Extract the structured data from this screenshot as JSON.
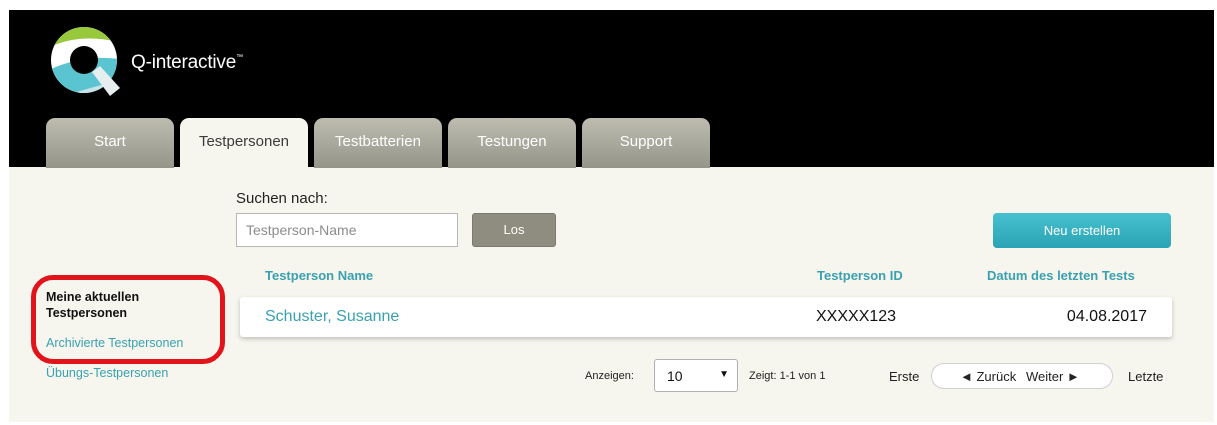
{
  "app": {
    "brand": "Q-interactive",
    "trademark": "™"
  },
  "tabs": [
    {
      "label": "Start"
    },
    {
      "label": "Testpersonen",
      "active": true
    },
    {
      "label": "Testbatterien"
    },
    {
      "label": "Testungen"
    },
    {
      "label": "Support"
    }
  ],
  "search": {
    "label": "Suchen nach:",
    "placeholder": "Testperson-Name",
    "value": "",
    "button_label": "Los"
  },
  "actions": {
    "new_label": "Neu erstellen"
  },
  "sidebar": {
    "items": [
      {
        "label": "Meine aktuellen Testpersonen",
        "active": true
      },
      {
        "label": "Archivierte Testpersonen"
      },
      {
        "label": "Übungs-Testpersonen"
      }
    ]
  },
  "table": {
    "columns": [
      "Testperson Name",
      "Testperson ID",
      "Datum des letzten Tests"
    ],
    "rows": [
      {
        "name": "Schuster, Susanne",
        "id": "XXXXX123",
        "date": "04.08.2017"
      }
    ]
  },
  "pagination": {
    "show_label": "Anzeigen:",
    "page_size": "10",
    "summary": "Zeigt: 1-1 von 1",
    "first": "Erste",
    "prev": "◄ Zurück",
    "next": "Weiter ►",
    "last": "Letzte"
  },
  "colors": {
    "accent": "#3aa1b0",
    "header": "#000000",
    "tab": "#a8a79b",
    "highlight": "#e2141b",
    "new_button": "#35b2c1"
  },
  "icons": {
    "logo": "q-interactive-logo-icon",
    "dropdown": "chevron-down-icon"
  }
}
